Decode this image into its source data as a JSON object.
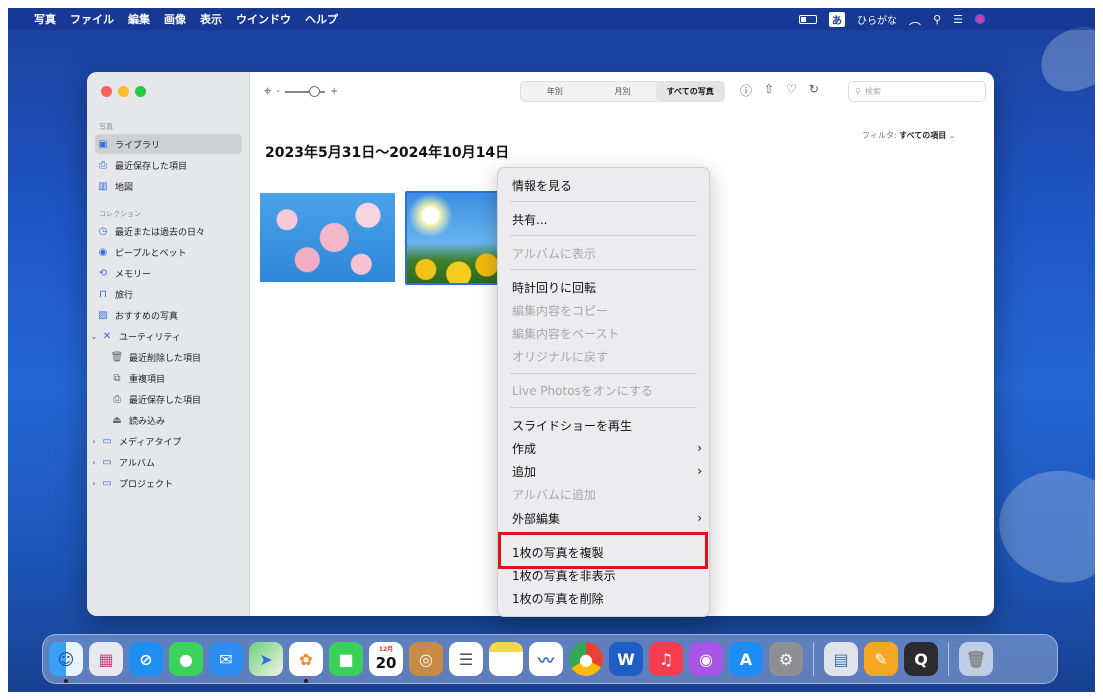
{
  "menubar": {
    "apple": "",
    "items": [
      "写真",
      "ファイル",
      "編集",
      "画像",
      "表示",
      "ウインドウ",
      "ヘルプ"
    ],
    "ime_badge": "あ",
    "ime_label": "ひらがな"
  },
  "toolbar": {
    "zoom_minus": "-",
    "zoom_plus": "+",
    "segments": [
      "年別",
      "月別",
      "すべての写真"
    ],
    "active_segment": "すべての写真",
    "search_placeholder": "検索"
  },
  "sidebar": {
    "section_photos": "写真",
    "section_collections": "コレクション",
    "items": [
      {
        "label": "ライブラリ",
        "icon": "library-icon"
      },
      {
        "label": "最近保存した項目",
        "icon": "recent-saved-icon"
      },
      {
        "label": "地図",
        "icon": "map-icon"
      },
      {
        "label": "最近または過去の日々",
        "icon": "clock-icon"
      },
      {
        "label": "ピープルとペット",
        "icon": "person-icon"
      },
      {
        "label": "メモリー",
        "icon": "memories-icon"
      },
      {
        "label": "旅行",
        "icon": "suitcase-icon"
      },
      {
        "label": "おすすめの写真",
        "icon": "featured-icon"
      },
      {
        "label": "ユーティリティ",
        "icon": "tools-icon"
      },
      {
        "label": "最近削除した項目",
        "icon": "trash-icon"
      },
      {
        "label": "重複項目",
        "icon": "duplicate-icon"
      },
      {
        "label": "最近保存した項目",
        "icon": "recent-saved-icon"
      },
      {
        "label": "読み込み",
        "icon": "import-icon"
      },
      {
        "label": "メディアタイプ",
        "icon": "folder-icon"
      },
      {
        "label": "アルバム",
        "icon": "folder-icon"
      },
      {
        "label": "プロジェクト",
        "icon": "folder-icon"
      }
    ]
  },
  "main": {
    "filter_label": "フィルタ:",
    "filter_value": "すべての項目",
    "date_range": "2023年5月31日〜2024年10月14日"
  },
  "context_menu": {
    "items": [
      {
        "label": "情報を見る",
        "enabled": true
      },
      {
        "label": "共有...",
        "enabled": true
      },
      {
        "label": "アルバムに表示",
        "enabled": false
      },
      {
        "label": "時計回りに回転",
        "enabled": true
      },
      {
        "label": "編集内容をコピー",
        "enabled": false
      },
      {
        "label": "編集内容をペースト",
        "enabled": false
      },
      {
        "label": "オリジナルに戻す",
        "enabled": false
      },
      {
        "label": "Live Photosをオンにする",
        "enabled": false
      },
      {
        "label": "スライドショーを再生",
        "enabled": true
      },
      {
        "label": "作成",
        "enabled": true,
        "submenu": true
      },
      {
        "label": "追加",
        "enabled": true,
        "submenu": true
      },
      {
        "label": "アルバムに追加",
        "enabled": false
      },
      {
        "label": "外部編集",
        "enabled": true,
        "submenu": true
      },
      {
        "label": "1枚の写真を複製",
        "enabled": true
      },
      {
        "label": "1枚の写真を非表示",
        "enabled": true
      },
      {
        "label": "1枚の写真を削除",
        "enabled": true
      }
    ]
  },
  "dock": {
    "calendar_month": "12月",
    "calendar_day": "20",
    "icons": [
      "finder-icon",
      "launchpad-icon",
      "safari-icon",
      "messages-icon",
      "mail-icon",
      "maps-icon",
      "photos-icon",
      "facetime-icon",
      "calendar-icon",
      "contacts-icon",
      "reminders-icon",
      "notes-icon",
      "freeform-icon",
      "chrome-icon",
      "word-icon",
      "music-icon",
      "podcasts-icon",
      "appstore-icon",
      "settings-icon",
      "preview-icon",
      "pages-icon",
      "quicktime-icon",
      "trash-icon"
    ]
  }
}
